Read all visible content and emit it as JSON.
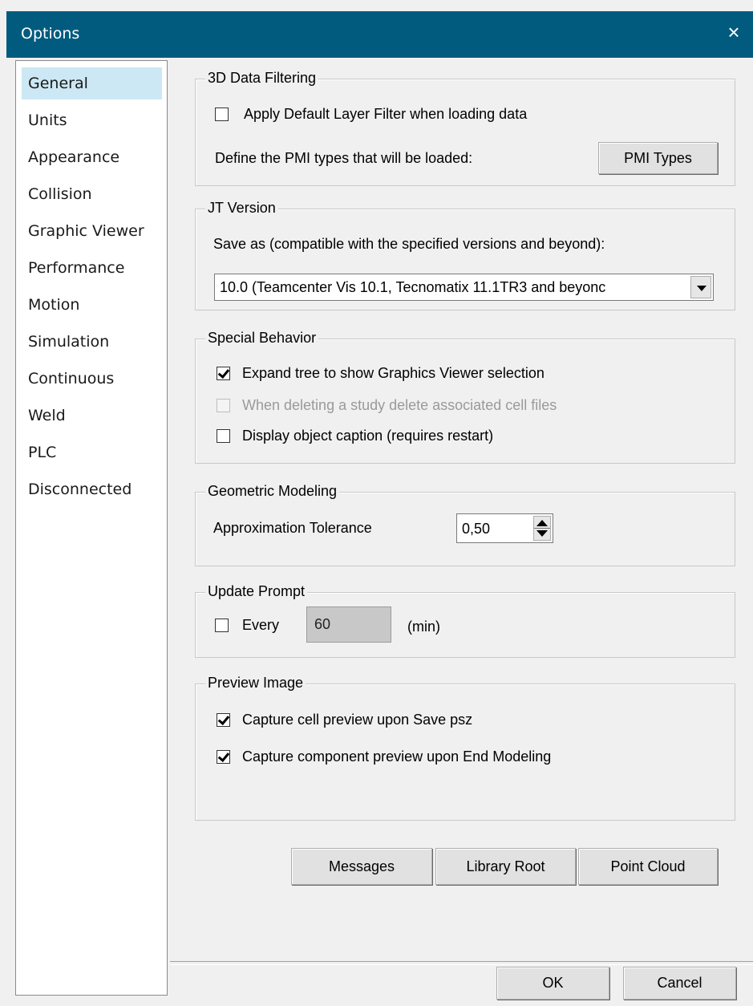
{
  "window": {
    "title": "Options",
    "close_glyph": "×"
  },
  "nav": {
    "items": [
      {
        "label": "General",
        "selected": true
      },
      {
        "label": "Units"
      },
      {
        "label": "Appearance"
      },
      {
        "label": "Collision"
      },
      {
        "label": "Graphic Viewer"
      },
      {
        "label": "Performance"
      },
      {
        "label": "Motion"
      },
      {
        "label": "Simulation"
      },
      {
        "label": "Continuous"
      },
      {
        "label": "Weld"
      },
      {
        "label": "PLC"
      },
      {
        "label": "Disconnected"
      }
    ]
  },
  "data_filtering": {
    "legend": "3D Data Filtering",
    "apply_filter_label": "Apply Default Layer Filter when loading data",
    "apply_filter_checked": false,
    "pmi_text": "Define the PMI types that will be loaded:",
    "pmi_button": "PMI Types"
  },
  "jt_version": {
    "legend": "JT Version",
    "save_as_text": "Save as (compatible with the specified versions and beyond):",
    "selected_value": "10.0 (Teamcenter Vis 10.1, Tecnomatix 11.1TR3 and beyonc"
  },
  "special_behavior": {
    "legend": "Special Behavior",
    "expand_tree_label": "Expand tree to show Graphics Viewer selection",
    "expand_tree_checked": true,
    "delete_cells_label": "When deleting a study delete associated cell files",
    "delete_cells_checked": false,
    "delete_cells_enabled": false,
    "display_caption_label": "Display object caption (requires restart)",
    "display_caption_checked": false
  },
  "geometric_modeling": {
    "legend": "Geometric Modeling",
    "tolerance_label": "Approximation Tolerance",
    "tolerance_value": "0,50"
  },
  "update_prompt": {
    "legend": "Update Prompt",
    "every_label": "Every",
    "every_checked": false,
    "every_value": "60",
    "unit_label": "(min)"
  },
  "preview_image": {
    "legend": "Preview Image",
    "cell_preview_label": "Capture cell preview upon Save psz",
    "cell_preview_checked": true,
    "component_preview_label": "Capture component preview upon End Modeling",
    "component_preview_checked": true
  },
  "bottom_buttons": {
    "messages": "Messages",
    "library_root": "Library Root",
    "point_cloud": "Point Cloud"
  },
  "footer": {
    "ok": "OK",
    "cancel": "Cancel"
  },
  "colors": {
    "title_bar": "#005b7f",
    "nav_selected": "#cce8f4",
    "window_bg": "#f0f0f0"
  }
}
